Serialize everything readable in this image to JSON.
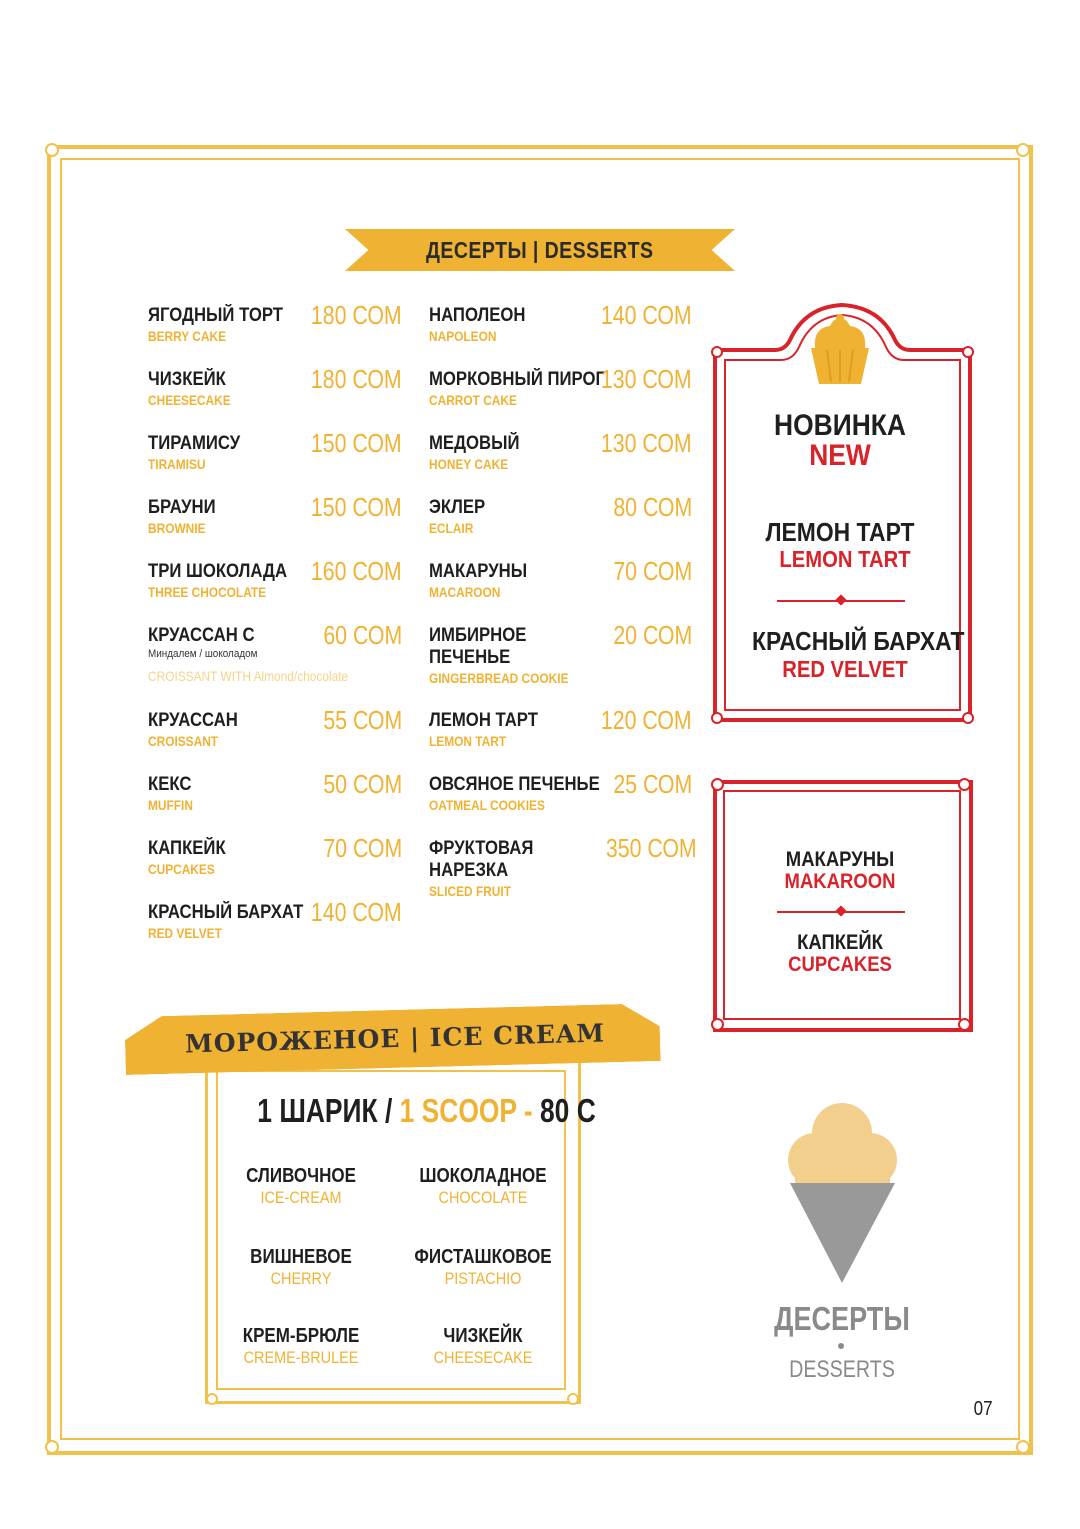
{
  "desserts_header": "ДЕСЕРТЫ | DESSERTS",
  "currency_suffix": "СОМ",
  "left_column": [
    {
      "ru": "ЯГОДНЫЙ ТОРТ",
      "en": "BERRY CAKE",
      "price": "180 СОМ"
    },
    {
      "ru": "ЧИЗКЕЙК",
      "en": "CHEESECAKE",
      "price": "180 СОМ"
    },
    {
      "ru": "ТИРАМИСУ",
      "en": "TIRAMISU",
      "price": "150 СОМ"
    },
    {
      "ru": "БРАУНИ",
      "en": "BROWNIE",
      "price": "150 СОМ"
    },
    {
      "ru": "ТРИ ШОКОЛАДА",
      "en": "THREE CHOCOLATE",
      "price": "160 СОМ"
    },
    {
      "ru": "КРУАССАН С",
      "sub": "Миндалем / шоколадом",
      "en": "CROISSANT WITH Almond/chocolate",
      "price": "60 СОМ"
    },
    {
      "ru": "КРУАССАН",
      "en": "CROISSANT",
      "price": "55 СОМ"
    },
    {
      "ru": "КЕКС",
      "en": "MUFFIN",
      "price": "50 СОМ"
    },
    {
      "ru": "КАПКЕЙК",
      "en": "CUPCAKES",
      "price": "70 СОМ"
    },
    {
      "ru": "КРАСНЫЙ БАРХАТ",
      "en": "RED VELVET",
      "price": "140 СОМ"
    }
  ],
  "right_column": [
    {
      "ru": "НАПОЛЕОН",
      "en": "NAPOLEON",
      "price": "140 СОМ"
    },
    {
      "ru": "МОРКОВНЫЙ ПИРОГ",
      "en": "CARROT CAKE",
      "price": "130 СОМ"
    },
    {
      "ru": "МЕДОВЫЙ",
      "en": "HONEY CAKE",
      "price": "130 СОМ"
    },
    {
      "ru": "ЭКЛЕР",
      "en": "ECLAIR",
      "price": "80 СОМ"
    },
    {
      "ru": "МАКАРУНЫ",
      "en": "MACAROON",
      "price": "70 СОМ"
    },
    {
      "ru": "ИМБИРНОЕ",
      "ru2": "ПЕЧЕНЬЕ",
      "en": "GINGERBREAD COOKIE",
      "price": "20 СОМ"
    },
    {
      "ru": "ЛЕМОН ТАРТ",
      "en": "LEMON TART",
      "price": "120 СОМ"
    },
    {
      "ru": "ОВСЯНОЕ ПЕЧЕНЬЕ",
      "en": "OATMEAL COOKIES",
      "price": "25 СОМ"
    },
    {
      "ru": "ФРУКТОВАЯ",
      "ru2": "НАРЕЗКА",
      "en": "SLICED FRUIT",
      "price": "350 СОМ"
    }
  ],
  "new_box": {
    "title_ru": "НОВИНКА",
    "title_en": "NEW",
    "items": [
      {
        "ru": "ЛЕМОН ТАРТ",
        "en": "LEMON TART"
      },
      {
        "ru": "КРАСНЫЙ БАРХАТ",
        "en": "RED VELVET"
      }
    ]
  },
  "promo_box": {
    "items": [
      {
        "ru": "МАКАРУНЫ",
        "en": "MAKAROON"
      },
      {
        "ru": "КАПКЕЙК",
        "en": "CUPCAKES"
      }
    ]
  },
  "ice_cream": {
    "header": "МОРОЖЕНОЕ | ICE CREAM",
    "price_ru": "1 ШАРИК /",
    "price_en": "1 SCOOP -",
    "price_value": "80 С",
    "flavors": [
      {
        "ru": "СЛИВОЧНОЕ",
        "en": "ICE-CREAM"
      },
      {
        "ru": "ШОКОЛАДНОЕ",
        "en": "CHOCOLATE"
      },
      {
        "ru": "ВИШНЕВОЕ",
        "en": "CHERRY"
      },
      {
        "ru": "ФИСТАШКОВОЕ",
        "en": "PISTACHIO"
      },
      {
        "ru": "КРЕМ-БРЮЛЕ",
        "en": "CREME-BRULEE"
      },
      {
        "ru": "ЧИЗКЕЙК",
        "en": "CHEESECAKE"
      }
    ]
  },
  "section_label": {
    "ru": "ДЕСЕРТЫ",
    "en": "DESSERTS"
  },
  "page_number": "07",
  "colors": {
    "gold": "#f0b232",
    "red": "#d8232a",
    "text": "#1f1f1f",
    "gray": "#888888"
  },
  "icons": [
    "cupcake-icon",
    "ice-cream-cone-icon"
  ]
}
